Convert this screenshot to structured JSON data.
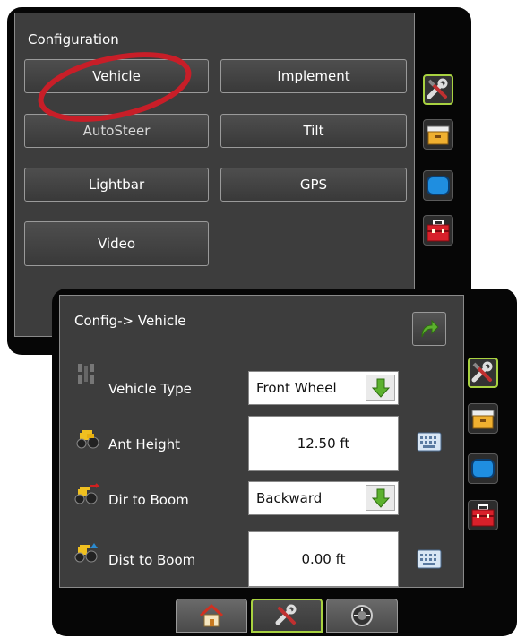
{
  "config_screen": {
    "title": "Configuration",
    "buttons": [
      "Vehicle",
      "Implement",
      "AutoSteer",
      "Tilt",
      "Lightbar",
      "GPS",
      "Video"
    ]
  },
  "vehicle_screen": {
    "title": "Config-> Vehicle",
    "rows": [
      {
        "label": "Vehicle Type",
        "value": "Front Wheel",
        "control": "dropdown"
      },
      {
        "label": "Ant Height",
        "value": "12.50 ft",
        "control": "keyboard"
      },
      {
        "label": "Dir to Boom",
        "value": "Backward",
        "control": "dropdown"
      },
      {
        "label": "Dist to Boom",
        "value": "0.00 ft",
        "control": "keyboard"
      }
    ]
  },
  "side_tabs": [
    "tools-icon",
    "briefcase-icon",
    "screen-icon",
    "toolbox-icon"
  ],
  "bottom_tabs": [
    "home-icon",
    "tools-icon",
    "gauge-icon"
  ],
  "colors": {
    "accent": "#a8d240",
    "highlight_oval": "#c81e28",
    "panel": "#3d3d3d"
  }
}
